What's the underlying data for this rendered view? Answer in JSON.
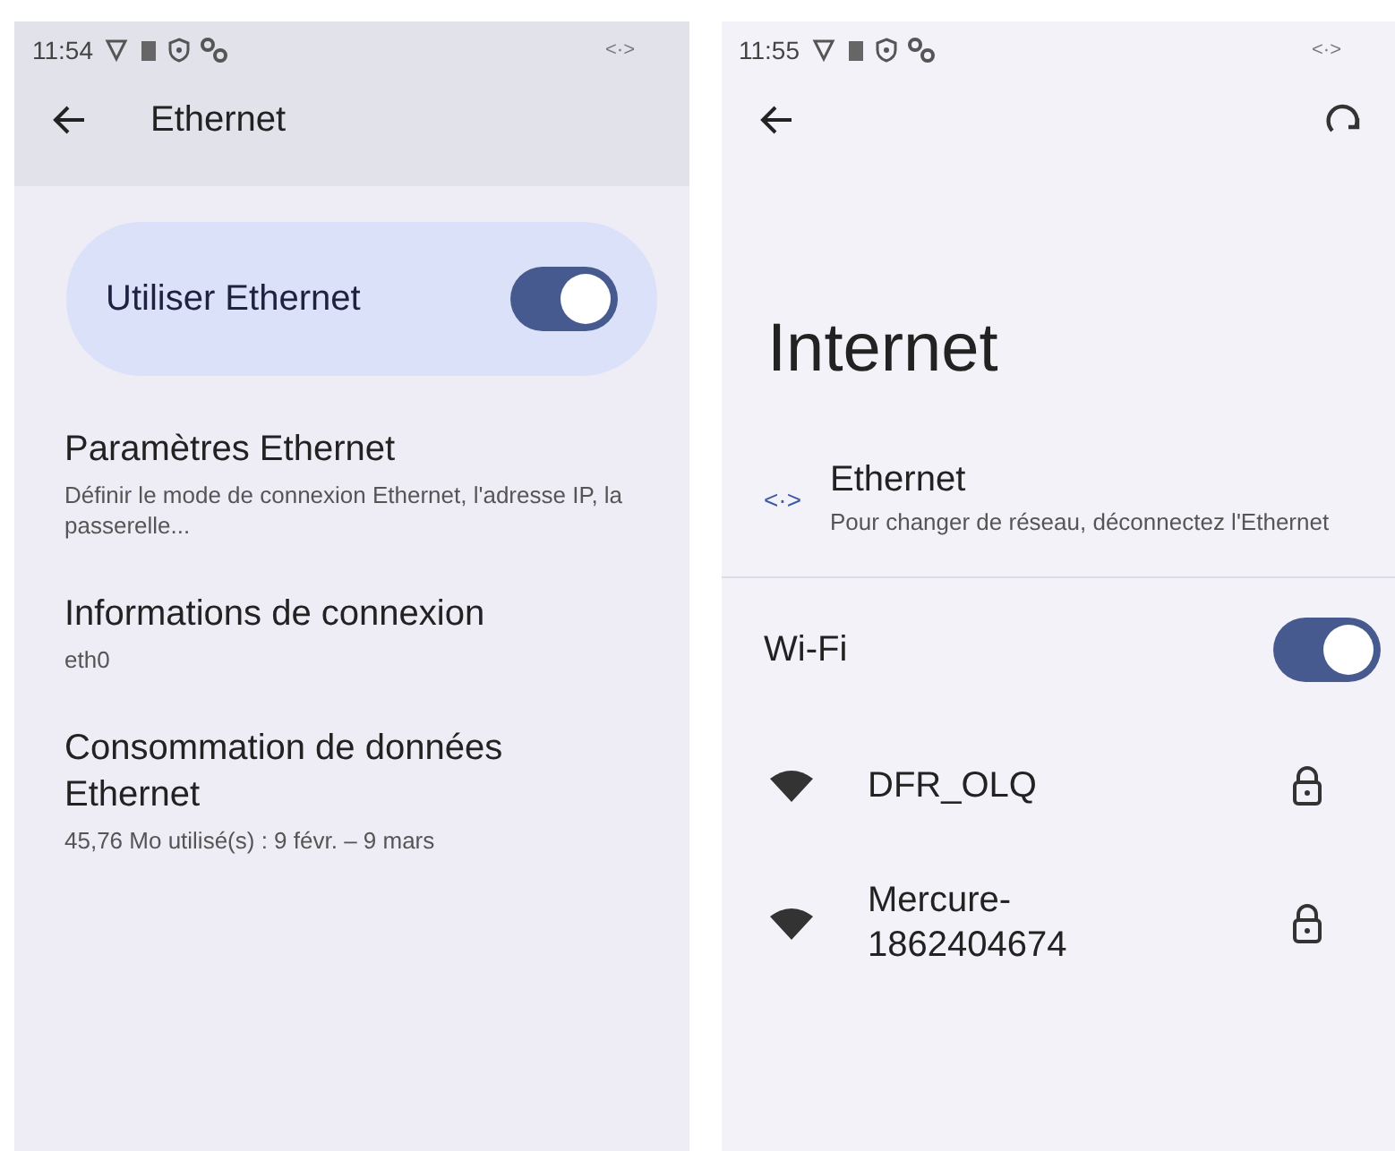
{
  "screens": [
    {
      "kind": "ethernet",
      "status_bar": {
        "time": "11:54",
        "center_glyph": "<·>"
      },
      "title": "Ethernet",
      "main_switch": {
        "label": "Utiliser Ethernet",
        "on": true
      },
      "items": [
        {
          "title": "Paramètres Ethernet",
          "subtitle": "Définir le mode de connexion Ethernet, l'adresse IP, la passerelle..."
        },
        {
          "title": "Informations de connexion",
          "subtitle": "eth0"
        },
        {
          "title": "Consommation de données Ethernet",
          "subtitle": "45,76 Mo utilisé(s) : 9 févr. – 9 mars"
        }
      ]
    },
    {
      "kind": "internet",
      "status_bar": {
        "time": "11:55",
        "center_glyph": "<·>"
      },
      "title": "Internet",
      "ethernet": {
        "glyph": "<·>",
        "title": "Ethernet",
        "subtitle": "Pour changer de réseau, déconnectez l'Ethernet"
      },
      "wifi": {
        "label": "Wi-Fi",
        "on": true
      },
      "networks": [
        {
          "name": "DFR_OLQ",
          "locked": true
        },
        {
          "name": "Mercure-\n1862404674",
          "locked": true
        }
      ]
    }
  ]
}
